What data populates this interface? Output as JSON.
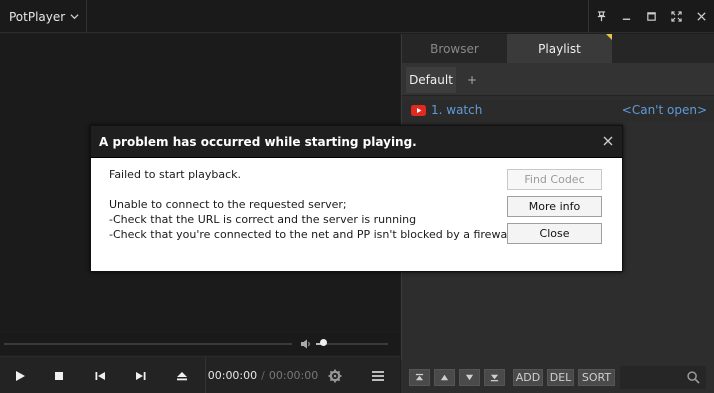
{
  "app": {
    "menu_label": "PotPlayer"
  },
  "window_controls": [
    "pin-icon",
    "minimize-icon",
    "maximize-icon",
    "fullscreen-icon",
    "close-icon"
  ],
  "player": {
    "time_current": "00:00:00",
    "time_separator": "/",
    "time_total": "00:00:00",
    "volume_level": 0.1
  },
  "panel": {
    "tabs": [
      {
        "label": "Browser",
        "active": false
      },
      {
        "label": "Playlist",
        "active": true
      }
    ],
    "playlist_tabs": {
      "default_label": "Default",
      "add_label": "+"
    },
    "items": [
      {
        "title": "1. watch",
        "status": "<Can't open>",
        "icon": "youtube-icon"
      }
    ],
    "toolbar": {
      "add_label": "ADD",
      "del_label": "DEL",
      "sort_label": "SORT",
      "search_value": ""
    }
  },
  "dialog": {
    "title": "A problem has occurred while starting playing.",
    "line1": "Failed to start playback.",
    "line2": "Unable to connect to the requested server;",
    "line3": "-Check that the URL is correct and the server is running",
    "line4": "-Check that you're connected to the net and PP isn't blocked by a firewall",
    "buttons": {
      "find_codec": "Find Codec",
      "more_info": "More info",
      "close": "Close"
    }
  },
  "colors": {
    "link": "#5f9bd8",
    "accent_marker": "#e6c34a",
    "youtube": "#e02a20"
  }
}
